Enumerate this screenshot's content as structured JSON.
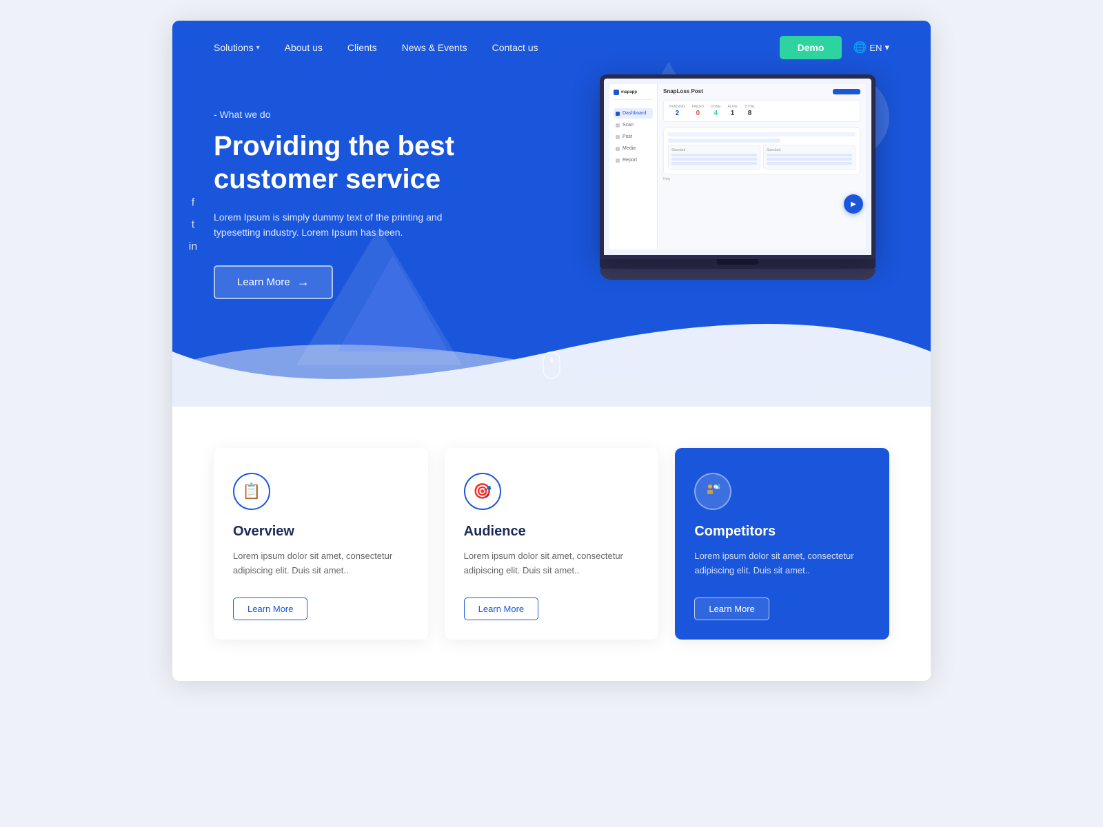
{
  "nav": {
    "logo": "",
    "links": [
      {
        "label": "Solutions",
        "hasDropdown": true
      },
      {
        "label": "About us",
        "hasDropdown": false
      },
      {
        "label": "Clients",
        "hasDropdown": false
      },
      {
        "label": "News & Events",
        "hasDropdown": false
      },
      {
        "label": "Contact us",
        "hasDropdown": false
      }
    ],
    "demo_button": "Demo",
    "lang": "EN"
  },
  "hero": {
    "subtitle": "- What we do",
    "title": "Providing the best customer service",
    "description": "Lorem Ipsum is simply dummy text of the printing and typesetting industry. Lorem Ipsum has been.",
    "learn_more_btn": "Learn More",
    "arrow": "→"
  },
  "social": {
    "facebook": "f",
    "twitter": "t",
    "linkedin": "in"
  },
  "mock_app": {
    "title": "SnapLoss Post",
    "logo": "mapapp",
    "nav_items": [
      "Dashboard",
      "Scan",
      "Post",
      "Media",
      "Report"
    ],
    "stats": [
      {
        "label": "PENDING",
        "value": "2",
        "color": "blue"
      },
      {
        "label": "FAILED",
        "value": "0",
        "color": "red"
      },
      {
        "label": "DONE",
        "value": "4",
        "color": "green"
      },
      {
        "label": "ALIVE",
        "value": "1",
        "color": ""
      },
      {
        "label": "TOTAL",
        "value": "8",
        "color": ""
      }
    ]
  },
  "cards": [
    {
      "id": "overview",
      "icon": "📋",
      "title": "Overview",
      "description": "Lorem ipsum dolor sit amet, consectetur adipiscing elit. Duis sit amet..",
      "learn_more": "Learn More",
      "highlighted": false
    },
    {
      "id": "audience",
      "icon": "🎯",
      "title": "Audience",
      "description": "Lorem ipsum dolor sit amet, consectetur adipiscing elit. Duis sit amet..",
      "learn_more": "Learn More",
      "highlighted": false
    },
    {
      "id": "competitors",
      "icon": "👥",
      "title": "Competitors",
      "description": "Lorem ipsum dolor sit amet, consectetur adipiscing elit. Duis sit amet..",
      "learn_more": "Learn More",
      "highlighted": true
    }
  ],
  "colors": {
    "primary": "#1a56db",
    "accent": "#2dd4a0",
    "hero_bg": "#1a56db",
    "white": "#ffffff"
  }
}
